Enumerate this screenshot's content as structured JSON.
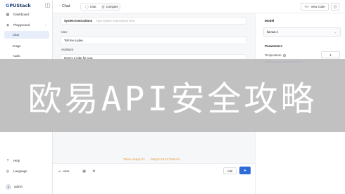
{
  "app": {
    "logo_mark": "G",
    "logo_text": "PUStack"
  },
  "sidebar": {
    "dashboard": "Dashboard",
    "playground": "Playground",
    "chat": "Chat",
    "image": "Image",
    "audio": "Audio",
    "help": "Help",
    "language": "Language",
    "user": "admin"
  },
  "header": {
    "title": "Chat",
    "tabs": [
      {
        "label": "Chat",
        "active": true
      },
      {
        "label": "Compare",
        "active": false
      }
    ],
    "view_code": "View Code"
  },
  "chat": {
    "system_label": "System instructions",
    "system_placeholder": "Type system instructions here",
    "messages": [
      {
        "role": "User",
        "text": "Tell me a joke."
      },
      {
        "role": "Assistant",
        "text": "Here's a joke for you:"
      }
    ],
    "stats": {
      "tokens": "Token Usage: 51",
      "output": "Output: 53.13 Tokens/s"
    }
  },
  "composer": {
    "role_label": "User",
    "add_label": "Add"
  },
  "panel": {
    "model_title": "Model",
    "model_value": "llama3.2",
    "params_title": "Parameters",
    "temperature_label": "Temperature",
    "temperature_value": "1",
    "temperature_fraction": 0.5
  },
  "overlay": {
    "text": "欧易API安全攻略"
  },
  "colors": {
    "accent": "#2f6bd8",
    "stats": "#e89a3c"
  }
}
